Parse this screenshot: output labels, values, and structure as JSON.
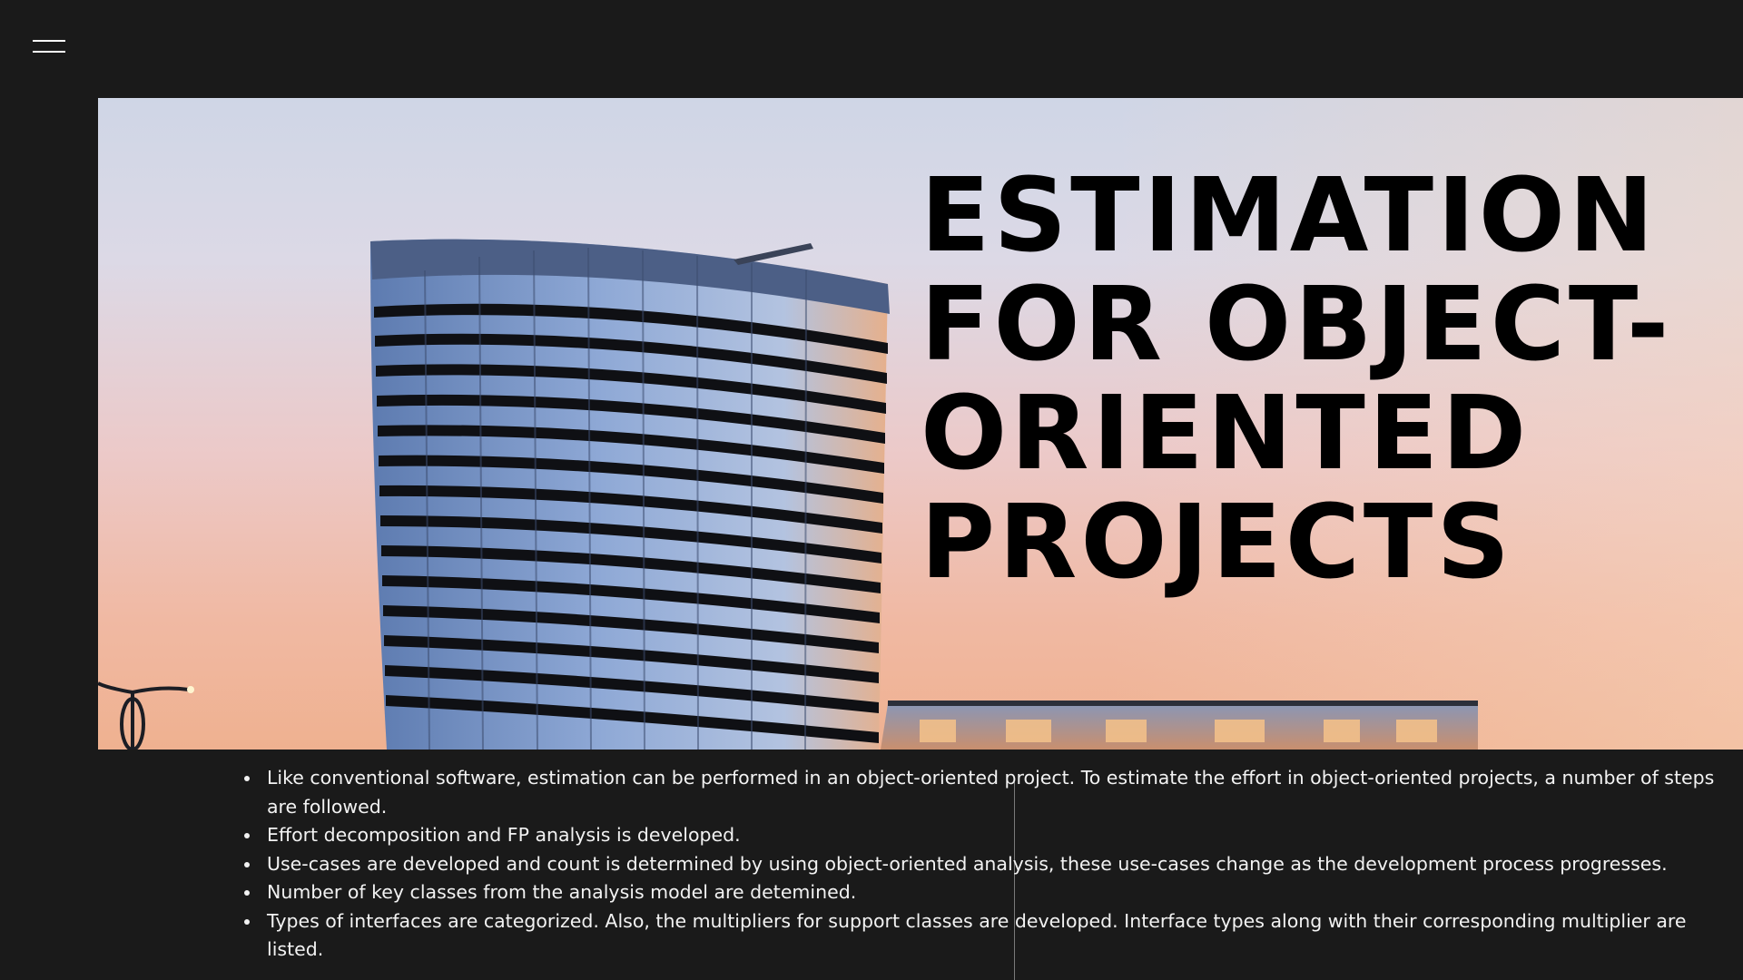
{
  "header": {
    "menu_icon": "hamburger-menu-icon"
  },
  "hero": {
    "title_lines": [
      "ESTIMATION",
      "FOR OBJECT-",
      "ORIENTED",
      "PROJECTS"
    ]
  },
  "content": {
    "bullets": [
      "Like conventional software, estimation can be performed in an object-oriented project. To estimate the effort in object-oriented projects, a number of steps are followed.",
      "Effort decomposition and FP analysis is developed.",
      "Use-cases are developed and count is determined by using object-oriented analysis, these use-cases change as the development process progresses.",
      "Number of key classes from the analysis model are detemined.",
      "Types of interfaces are categorized. Also, the multipliers for support classes are developed. Interface types along with their corresponding multiplier are listed."
    ]
  },
  "colors": {
    "background": "#1a1a1a",
    "title_text": "#000000",
    "body_text": "#f2f2f2"
  }
}
